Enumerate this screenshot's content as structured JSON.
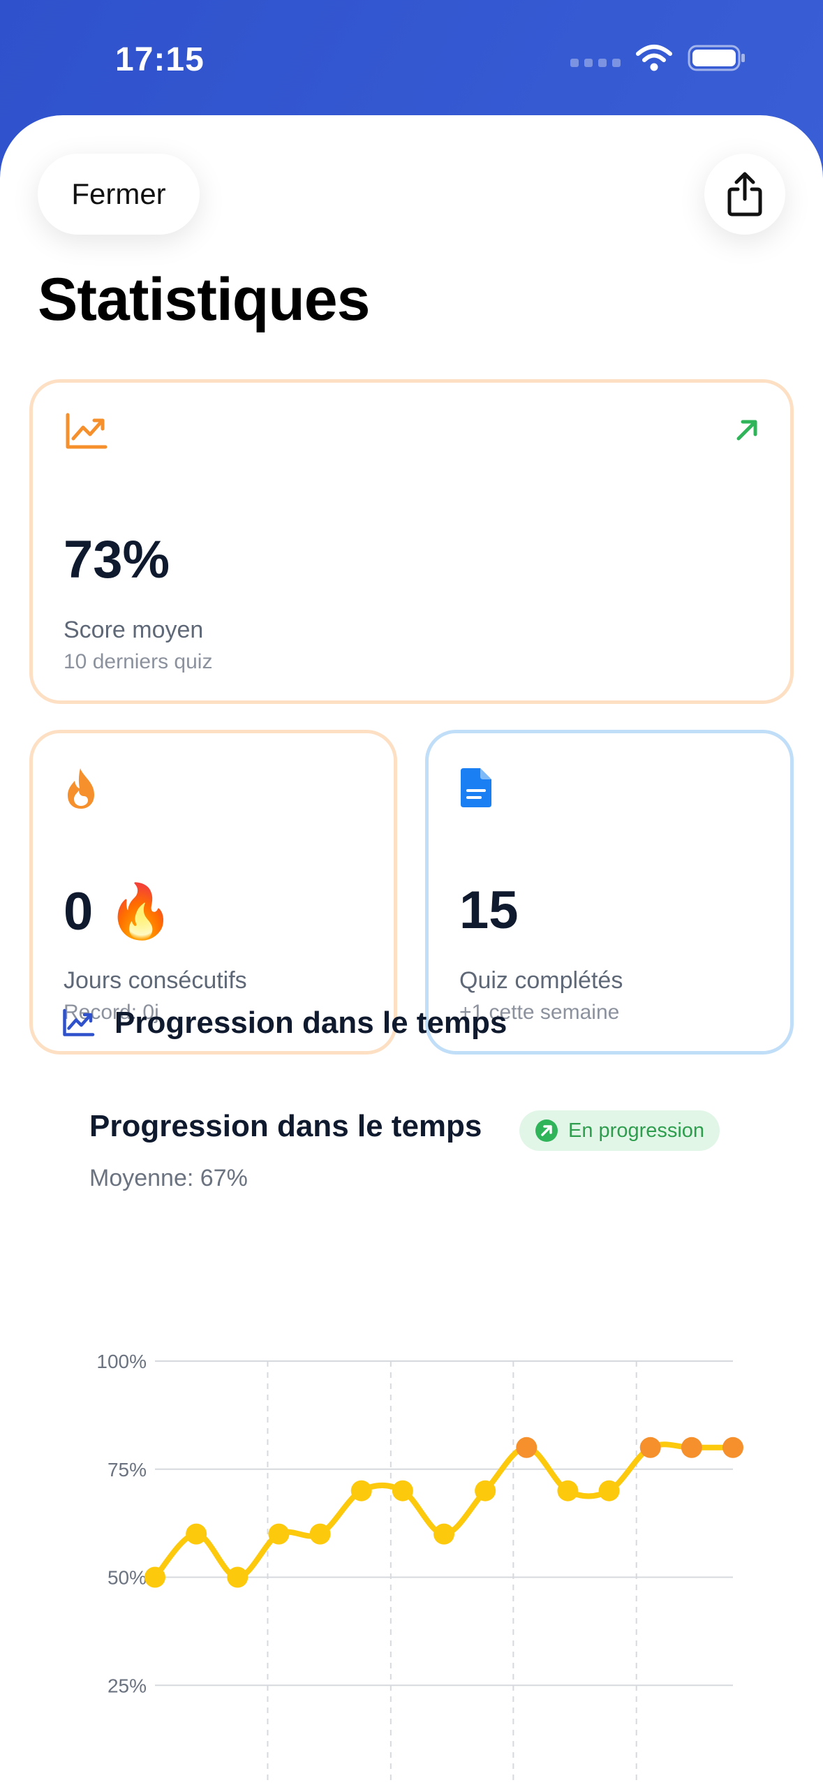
{
  "status_bar": {
    "time": "17:15"
  },
  "header": {
    "close_label": "Fermer",
    "title": "Statistiques"
  },
  "cards": {
    "avg": {
      "value": "73%",
      "label": "Score moyen",
      "sub": "10 derniers quiz"
    },
    "streak": {
      "value": "0 🔥",
      "label": "Jours consécutifs",
      "sub": "Record: 0j"
    },
    "quiz": {
      "value": "15",
      "label": "Quiz complétés",
      "sub": "+1 cette semaine"
    }
  },
  "section": {
    "title": "Progression dans le temps"
  },
  "chart_header": {
    "title": "Progression dans le temps",
    "badge": "En progression",
    "subtitle": "Moyenne: 67%"
  },
  "colors": {
    "accent_blue": "#2f52cc",
    "card_orange": "#f5902d",
    "card_blue": "#1a7ff2",
    "line_yellow": "#fcc90d",
    "point_orange": "#f5902d",
    "trend_green": "#2fb45a"
  },
  "icons": {
    "share": "share-icon",
    "avg_card": "trending-up-icon",
    "avg_trend": "arrow-up-right-icon",
    "streak_card": "flame-icon",
    "quiz_card": "document-icon",
    "section": "trending-up-icon",
    "badge": "arrow-up-right-icon"
  },
  "chart_data": {
    "type": "line",
    "y_ticks": [
      "100%",
      "75%",
      "50%",
      "25%"
    ],
    "ylim": [
      0,
      100
    ],
    "grid": true,
    "series": [
      {
        "values": [
          50,
          60,
          50,
          60,
          60,
          70,
          70,
          60,
          70,
          80,
          70,
          70,
          80,
          80,
          80
        ],
        "highlighted": [
          false,
          false,
          false,
          false,
          false,
          false,
          false,
          false,
          false,
          true,
          false,
          false,
          true,
          true,
          true
        ]
      }
    ]
  }
}
